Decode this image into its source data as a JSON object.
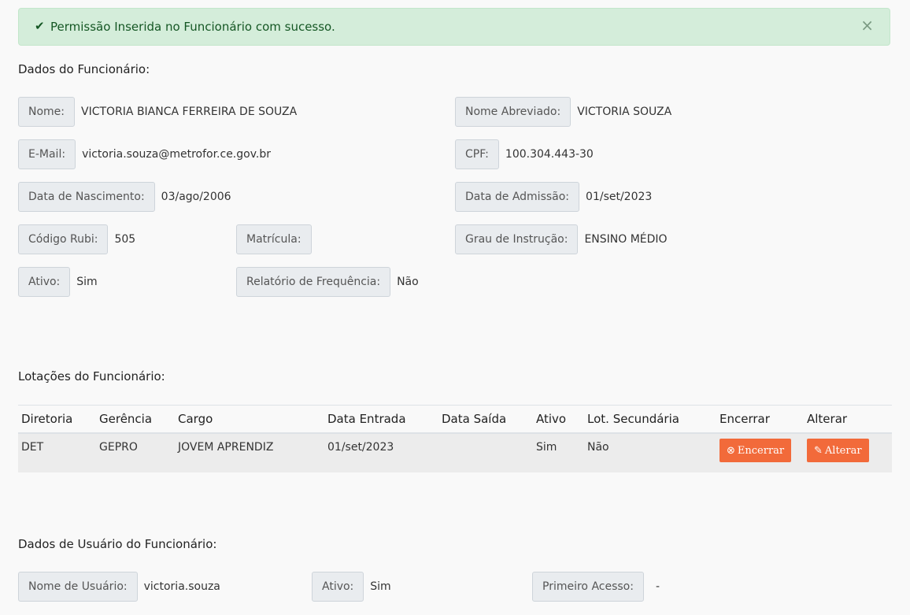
{
  "alert": {
    "message": "Permissão Inserida no Funcionário com sucesso.",
    "close": "×"
  },
  "employee": {
    "title": "Dados do Funcionário:",
    "fields": {
      "nome": {
        "label": "Nome:",
        "value": "VICTORIA BIANCA FERREIRA DE SOUZA"
      },
      "nome_abreviado": {
        "label": "Nome Abreviado:",
        "value": "VICTORIA SOUZA"
      },
      "email": {
        "label": "E-Mail:",
        "value": "victoria.souza@metrofor.ce.gov.br"
      },
      "cpf": {
        "label": "CPF:",
        "value": "100.304.443-30"
      },
      "nascimento": {
        "label": "Data de Nascimento:",
        "value": "03/ago/2006"
      },
      "admissao": {
        "label": "Data de Admissão:",
        "value": "01/set/2023"
      },
      "codigo_rubi": {
        "label": "Código Rubi:",
        "value": "505"
      },
      "matricula": {
        "label": "Matrícula:",
        "value": ""
      },
      "grau_instrucao": {
        "label": "Grau de Instrução:",
        "value": "ENSINO MÉDIO"
      },
      "ativo": {
        "label": "Ativo:",
        "value": "Sim"
      },
      "relatorio_frequencia": {
        "label": "Relatório de Frequência:",
        "value": "Não"
      }
    }
  },
  "lotacoes": {
    "title": "Lotações do Funcionário:",
    "columns": [
      "Diretoria",
      "Gerência",
      "Cargo",
      "Data Entrada",
      "Data Saída",
      "Ativo",
      "Lot. Secundária",
      "Encerrar",
      "Alterar"
    ],
    "rows": [
      {
        "diretoria": "DET",
        "gerencia": "GEPRO",
        "cargo": "JOVEM APRENDIZ",
        "data_entrada": "01/set/2023",
        "data_saida": "",
        "ativo": "Sim",
        "lot_secundaria": "Não",
        "encerrar_label": "Encerrar",
        "alterar_label": "Alterar"
      }
    ]
  },
  "usuario": {
    "title": "Dados de Usuário do Funcionário:",
    "fields": {
      "nome_usuario": {
        "label": "Nome de Usuário:",
        "value": "victoria.souza"
      },
      "ativo": {
        "label": "Ativo:",
        "value": "Sim"
      },
      "primeiro_acesso": {
        "label": "Primeiro Acesso:",
        "value": "-"
      }
    }
  },
  "colors": {
    "alert_bg": "#d4edda",
    "alert_text": "#155724",
    "button_bg": "#f26a3a"
  },
  "icons": {
    "alert": "check-icon",
    "close": "close-icon",
    "encerrar": "circle-x-icon",
    "alterar": "paperclip-icon"
  }
}
